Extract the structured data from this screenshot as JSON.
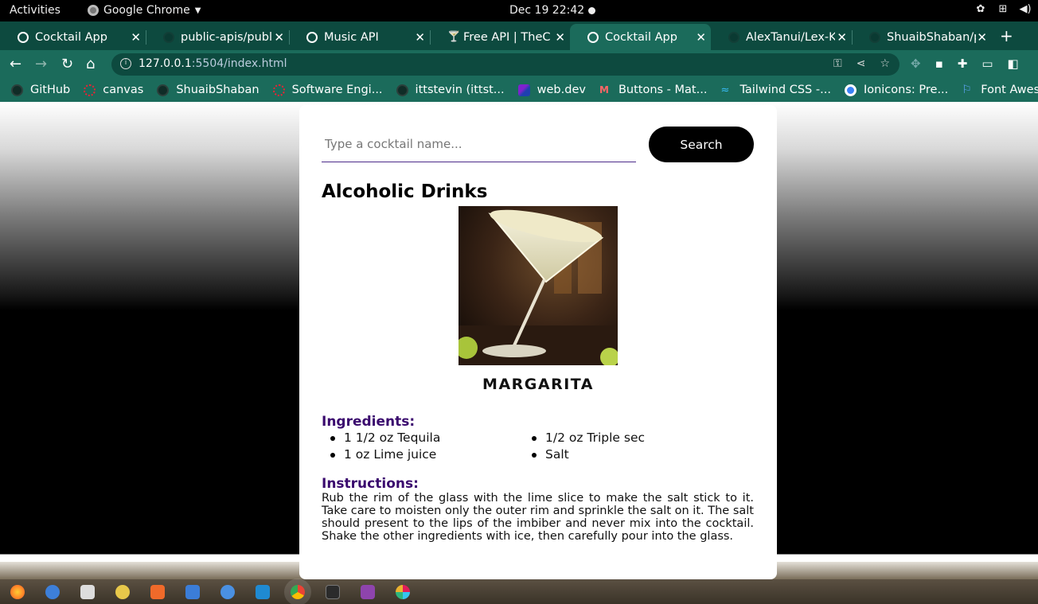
{
  "system": {
    "activities": "Activities",
    "app_name": "Google Chrome",
    "clock": "Dec 19  22:42"
  },
  "tabs": [
    {
      "title": "Cocktail App",
      "icon": "globe-icon",
      "active": false
    },
    {
      "title": "public-apis/publ",
      "icon": "github-icon",
      "active": false
    },
    {
      "title": "Music API",
      "icon": "globe-icon",
      "active": false
    },
    {
      "title": "Free API | TheCo",
      "icon": "cocktail-glass-icon",
      "active": false
    },
    {
      "title": "Cocktail App",
      "icon": "globe-icon",
      "active": true
    },
    {
      "title": "AlexTanui/Lex-K",
      "icon": "github-icon",
      "active": false
    },
    {
      "title": "ShuaibShaban/p",
      "icon": "github-icon",
      "active": false
    }
  ],
  "address_bar": {
    "host": "127.0.0.1",
    "path": ":5504/index.html"
  },
  "bookmarks": [
    {
      "label": "GitHub",
      "icon": "github-icon"
    },
    {
      "label": "canvas",
      "icon": "canvas-icon"
    },
    {
      "label": "ShuaibShaban",
      "icon": "github-icon"
    },
    {
      "label": "Software Engi...",
      "icon": "canvas-icon"
    },
    {
      "label": "ittstevin (ittst...",
      "icon": "github-icon"
    },
    {
      "label": "web.dev",
      "icon": "webdev-icon"
    },
    {
      "label": "Buttons - Mat...",
      "icon": "material-icon"
    },
    {
      "label": "Tailwind CSS -...",
      "icon": "tailwind-icon"
    },
    {
      "label": "Ionicons: Pre...",
      "icon": "ionicons-icon"
    },
    {
      "label": "Font Awesome",
      "icon": "font-awesome-flag-icon"
    }
  ],
  "page": {
    "search_placeholder": "Type a cocktail name...",
    "search_value": "",
    "search_button": "Search",
    "section_title": "Alcoholic Drinks",
    "drink": {
      "name": "MARGARITA",
      "ingredients_label": "Ingredients:",
      "ingredients": [
        "1 1/2 oz Tequila",
        "1/2 oz Triple sec",
        "1 oz Lime juice",
        "Salt"
      ],
      "instructions_label": "Instructions:",
      "instructions": "Rub the rim of the glass with the lime slice to make the salt stick to it. Take care to moisten only the outer rim and sprinkle the salt on it. The salt should present to the lips of the imbiber and never mix into the cocktail. Shake the other ingredients with ice, then carefully pour into the glass."
    }
  },
  "colors": {
    "chrome_frame": "#0d4a3f",
    "chrome_toolbar": "#1b6b5b",
    "label_purple": "#3a0a6e",
    "search_button": "#000000"
  },
  "dock_apps": [
    "firefox-icon",
    "thunderbird-icon",
    "files-icon",
    "rhythmbox-icon",
    "software-icon",
    "writer-icon",
    "help-icon",
    "vscode-icon",
    "chrome-icon",
    "terminal-icon",
    "video-icon",
    "slack-icon"
  ]
}
